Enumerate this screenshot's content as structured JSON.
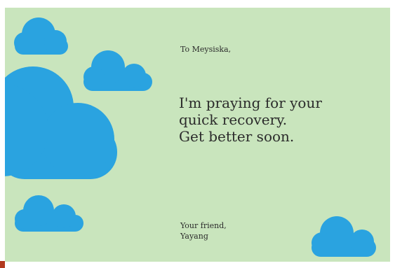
{
  "card": {
    "greeting": "To Meysiska,",
    "message_lines": [
      "I'm praying for your",
      "quick recovery.",
      "Get better soon."
    ],
    "signoff_lines": [
      "Your friend,",
      "Yayang"
    ]
  },
  "colors": {
    "background": "#c9e5bd",
    "cloud": "#2aa3e0",
    "text": "#2b2b2b",
    "corner_mark": "#b23a1e"
  },
  "icons": [
    "cloud-icon"
  ]
}
